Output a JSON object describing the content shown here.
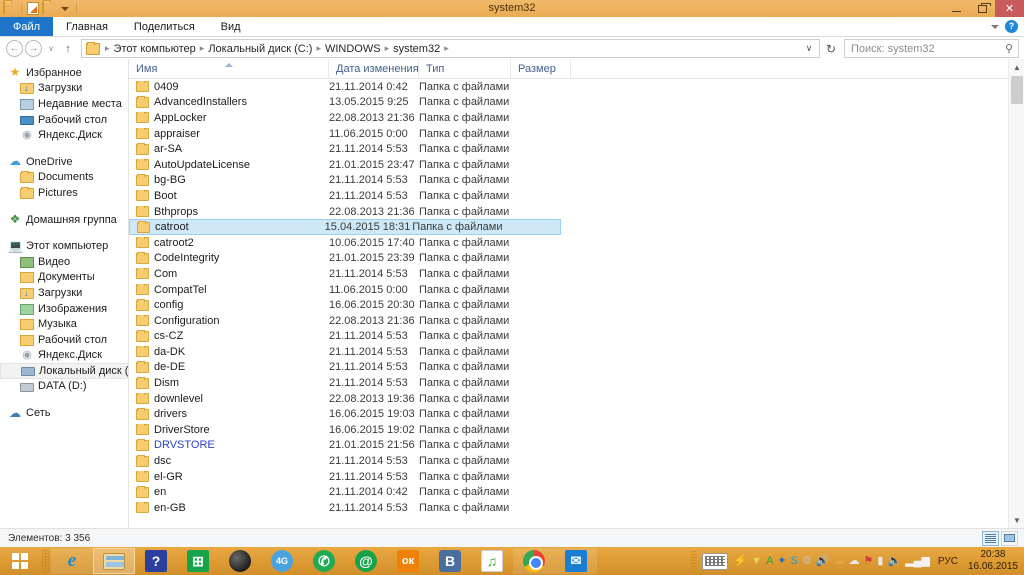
{
  "window": {
    "title": "system32",
    "quick_access": [
      "folder-icon",
      "properties-icon",
      "new-folder-icon",
      "customize-caret"
    ],
    "minimize_label": "",
    "maximize_label": "",
    "close_label": "✕"
  },
  "ribbon": {
    "tabs": [
      {
        "label": "Файл",
        "active_file": true
      },
      {
        "label": "Главная",
        "active_file": false
      },
      {
        "label": "Поделиться",
        "active_file": false
      },
      {
        "label": "Вид",
        "active_file": false
      }
    ],
    "expand_icon": "chevron-down-icon",
    "help_label": "?"
  },
  "address": {
    "back_label": "←",
    "forward_label": "→",
    "history_label": "∨",
    "up_label": "↑",
    "breadcrumbs": [
      "Этот компьютер",
      "Локальный диск (C:)",
      "WINDOWS",
      "system32"
    ],
    "separator": "▸",
    "dropdown_label": "∨",
    "refresh_label": "↻"
  },
  "search": {
    "placeholder": "Поиск: system32",
    "icon": "search-icon"
  },
  "sidebar": {
    "groups": [
      {
        "header": {
          "label": "Избранное",
          "icon": "star-icon"
        },
        "items": [
          {
            "label": "Загрузки",
            "icon": "downloads-icon"
          },
          {
            "label": "Недавние места",
            "icon": "recent-places-icon"
          },
          {
            "label": "Рабочий стол",
            "icon": "desktop-icon"
          },
          {
            "label": "Яндекс.Диск",
            "icon": "yandex-disk-icon"
          }
        ]
      },
      {
        "header": {
          "label": "OneDrive",
          "icon": "cloud-icon"
        },
        "items": [
          {
            "label": "Documents",
            "icon": "folder-icon"
          },
          {
            "label": "Pictures",
            "icon": "folder-icon"
          }
        ]
      },
      {
        "header": {
          "label": "Домашняя группа",
          "icon": "homegroup-icon"
        },
        "items": []
      },
      {
        "header": {
          "label": "Этот компьютер",
          "icon": "this-pc-icon"
        },
        "items": [
          {
            "label": "Видео",
            "icon": "video-folder-icon"
          },
          {
            "label": "Документы",
            "icon": "documents-folder-icon"
          },
          {
            "label": "Загрузки",
            "icon": "downloads-icon"
          },
          {
            "label": "Изображения",
            "icon": "pictures-folder-icon"
          },
          {
            "label": "Музыка",
            "icon": "music-folder-icon"
          },
          {
            "label": "Рабочий стол",
            "icon": "desktop-folder-icon"
          },
          {
            "label": "Яндекс.Диск",
            "icon": "yandex-disk-icon"
          },
          {
            "label": "Локальный диск (C",
            "icon": "drive-c-icon",
            "selected": true
          },
          {
            "label": "DATA (D:)",
            "icon": "drive-icon"
          }
        ]
      },
      {
        "header": {
          "label": "Сеть",
          "icon": "network-icon"
        },
        "items": []
      }
    ]
  },
  "filelist": {
    "columns": [
      {
        "key": "name",
        "label": "Имя",
        "sorted": true
      },
      {
        "key": "date",
        "label": "Дата изменения",
        "sorted": false
      },
      {
        "key": "type",
        "label": "Тип",
        "sorted": false
      },
      {
        "key": "size",
        "label": "Размер",
        "sorted": false
      }
    ],
    "rows": [
      {
        "name": "0409",
        "date": "21.11.2014 0:42",
        "type": "Папка с файлами",
        "size": ""
      },
      {
        "name": "AdvancedInstallers",
        "date": "13.05.2015 9:25",
        "type": "Папка с файлами",
        "size": ""
      },
      {
        "name": "AppLocker",
        "date": "22.08.2013 21:36",
        "type": "Папка с файлами",
        "size": ""
      },
      {
        "name": "appraiser",
        "date": "11.06.2015 0:00",
        "type": "Папка с файлами",
        "size": ""
      },
      {
        "name": "ar-SA",
        "date": "21.11.2014 5:53",
        "type": "Папка с файлами",
        "size": ""
      },
      {
        "name": "AutoUpdateLicense",
        "date": "21.01.2015 23:47",
        "type": "Папка с файлами",
        "size": ""
      },
      {
        "name": "bg-BG",
        "date": "21.11.2014 5:53",
        "type": "Папка с файлами",
        "size": ""
      },
      {
        "name": "Boot",
        "date": "21.11.2014 5:53",
        "type": "Папка с файлами",
        "size": ""
      },
      {
        "name": "Bthprops",
        "date": "22.08.2013 21:36",
        "type": "Папка с файлами",
        "size": ""
      },
      {
        "name": "catroot",
        "date": "15.04.2015 18:31",
        "type": "Папка с файлами",
        "size": "",
        "selected": true
      },
      {
        "name": "catroot2",
        "date": "10.06.2015 17:40",
        "type": "Папка с файлами",
        "size": ""
      },
      {
        "name": "CodeIntegrity",
        "date": "21.01.2015 23:39",
        "type": "Папка с файлами",
        "size": ""
      },
      {
        "name": "Com",
        "date": "21.11.2014 5:53",
        "type": "Папка с файлами",
        "size": ""
      },
      {
        "name": "CompatTel",
        "date": "11.06.2015 0:00",
        "type": "Папка с файлами",
        "size": ""
      },
      {
        "name": "config",
        "date": "16.06.2015 20:30",
        "type": "Папка с файлами",
        "size": ""
      },
      {
        "name": "Configuration",
        "date": "22.08.2013 21:36",
        "type": "Папка с файлами",
        "size": ""
      },
      {
        "name": "cs-CZ",
        "date": "21.11.2014 5:53",
        "type": "Папка с файлами",
        "size": ""
      },
      {
        "name": "da-DK",
        "date": "21.11.2014 5:53",
        "type": "Папка с файлами",
        "size": ""
      },
      {
        "name": "de-DE",
        "date": "21.11.2014 5:53",
        "type": "Папка с файлами",
        "size": ""
      },
      {
        "name": "Dism",
        "date": "21.11.2014 5:53",
        "type": "Папка с файлами",
        "size": ""
      },
      {
        "name": "downlevel",
        "date": "22.08.2013 19:36",
        "type": "Папка с файлами",
        "size": ""
      },
      {
        "name": "drivers",
        "date": "16.06.2015 19:03",
        "type": "Папка с файлами",
        "size": ""
      },
      {
        "name": "DriverStore",
        "date": "16.06.2015 19:02",
        "type": "Папка с файлами",
        "size": ""
      },
      {
        "name": "DRVSTORE",
        "date": "21.01.2015 21:56",
        "type": "Папка с файлами",
        "size": "",
        "compressed": true
      },
      {
        "name": "dsc",
        "date": "21.11.2014 5:53",
        "type": "Папка с файлами",
        "size": ""
      },
      {
        "name": "el-GR",
        "date": "21.11.2014 5:53",
        "type": "Папка с файлами",
        "size": ""
      },
      {
        "name": "en",
        "date": "21.11.2014 0:42",
        "type": "Папка с файлами",
        "size": ""
      },
      {
        "name": "en-GB",
        "date": "21.11.2014 5:53",
        "type": "Папка с файлами",
        "size": ""
      }
    ]
  },
  "scrollbar": {
    "up_label": "▲",
    "down_label": "▼"
  },
  "statusbar": {
    "items_text": "Элементов: 3 356",
    "view_details_icon": "details-view-icon",
    "view_thumbnails_icon": "thumbnails-view-icon"
  },
  "taskbar": {
    "start_label": "start-button",
    "buttons": [
      {
        "name": "internet-explorer",
        "glyph": "e",
        "style": "ico-ie",
        "state": "pinned"
      },
      {
        "name": "file-explorer",
        "glyph": "",
        "style": "ico-exp",
        "state": "active"
      },
      {
        "name": "help-app",
        "glyph": "?",
        "style": "ico-help",
        "state": "none"
      },
      {
        "name": "store-app",
        "glyph": "⊞",
        "style": "ico-store",
        "state": "none"
      },
      {
        "name": "media-player",
        "glyph": "",
        "style": "ico-media",
        "state": "none"
      },
      {
        "name": "4g-modem",
        "glyph": "4G",
        "style": "ico-4g",
        "state": "none"
      },
      {
        "name": "whatsapp",
        "glyph": "✆",
        "style": "ico-whatsapp",
        "state": "none"
      },
      {
        "name": "mail-agent",
        "glyph": "@",
        "style": "ico-mailat",
        "state": "none"
      },
      {
        "name": "odnoklassniki",
        "glyph": "ок",
        "style": "ico-ok",
        "state": "none"
      },
      {
        "name": "vkontakte",
        "glyph": "B",
        "style": "ico-vk",
        "state": "none"
      },
      {
        "name": "music-app",
        "glyph": "♫",
        "style": "ico-music",
        "state": "none"
      },
      {
        "name": "google-chrome",
        "glyph": "",
        "style": "ico-chrome",
        "state": "pinned"
      },
      {
        "name": "mail-client",
        "glyph": "✉",
        "style": "ico-mail",
        "state": "pinned"
      }
    ],
    "tray": {
      "keyboard_icon": "on-screen-keyboard-icon",
      "icons": [
        {
          "name": "flash-player-icon",
          "glyph": "⚡",
          "color": "#d93b3b"
        },
        {
          "name": "utorrent-icon",
          "glyph": "▼",
          "color": "#e8d24a"
        },
        {
          "name": "avast-icon",
          "glyph": "A",
          "color": "#27a83f"
        },
        {
          "name": "bluetooth-icon",
          "glyph": "✦",
          "color": "#1e6fd0"
        },
        {
          "name": "skype-icon",
          "glyph": "S",
          "color": "#1e9fd4"
        },
        {
          "name": "usb-icon",
          "glyph": "⚙",
          "color": "#c0c0c0"
        },
        {
          "name": "volume-alert-icon",
          "glyph": "🔊",
          "color": "#d93b3b"
        },
        {
          "name": "update-warning-icon",
          "glyph": "☁",
          "color": "#e8a33d"
        },
        {
          "name": "onedrive-icon",
          "glyph": "☁",
          "color": "#e8e8e8"
        },
        {
          "name": "security-alert-icon",
          "glyph": "⚑",
          "color": "#d93b3b"
        },
        {
          "name": "battery-icon",
          "glyph": "▮",
          "color": "#e8e8e8"
        },
        {
          "name": "volume-icon",
          "glyph": "🔈",
          "color": "#f2f2f2"
        },
        {
          "name": "network-signal-icon",
          "glyph": "▂▄▆",
          "color": "#f2f2f2"
        }
      ],
      "language": "РУС",
      "time": "20:38",
      "date": "16.06.2015"
    }
  }
}
